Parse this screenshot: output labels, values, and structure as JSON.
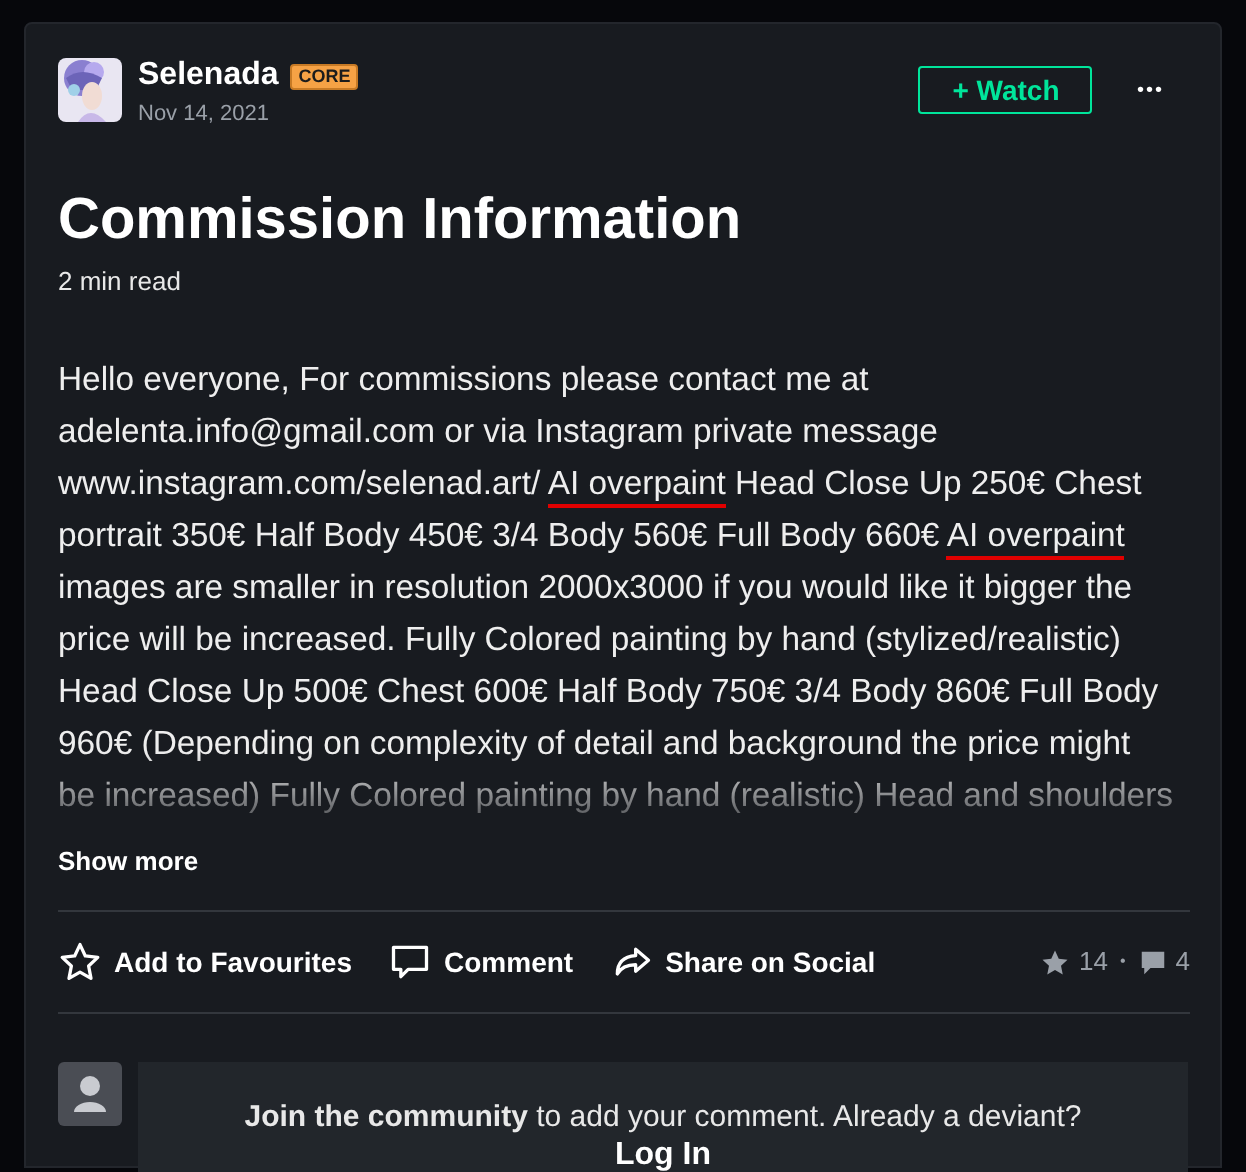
{
  "author": {
    "name": "Selenada",
    "badge": "CORE",
    "date": "Nov 14, 2021"
  },
  "watch_button": "+ Watch",
  "more_menu": "•••",
  "title": "Commission Information",
  "read_time": "2 min read",
  "body": [
    {
      "text": "Hello everyone, For commissions please contact me at adelenta.info@gmail.com or via Instagram private message www.instagram.com/selenad.art/ ",
      "underlined": false
    },
    {
      "text": "AI overpaint",
      "underlined": true
    },
    {
      "text": " Head Close Up 250€ Chest portrait 350€ Half Body 450€ 3/4 Body 560€ Full Body 660€ ",
      "underlined": false
    },
    {
      "text": "AI overpaint",
      "underlined": true
    },
    {
      "text": " images are smaller in resolution 2000x3000 if you would like it bigger the price will be increased. Fully Colored painting by hand (stylized/realistic) Head Close Up 500€ Chest 600€ Half Body 750€ 3/4 Body 860€ Full Body 960€ (Depending on complexity of detail and background the price might be increased) Fully Colored painting by hand (realistic) Head and shoulders",
      "underlined": false
    }
  ],
  "show_more": "Show more",
  "actions": [
    {
      "kind": "favourite",
      "label": "Add to Favourites"
    },
    {
      "kind": "comment",
      "label": "Comment"
    },
    {
      "kind": "share",
      "label": "Share on Social"
    }
  ],
  "stats": {
    "favourites": "14",
    "separator": "•",
    "comments": "4"
  },
  "join_prompt": {
    "text": "**Join the community** to add your comment. Already a deviant?",
    "link": "Log In"
  }
}
